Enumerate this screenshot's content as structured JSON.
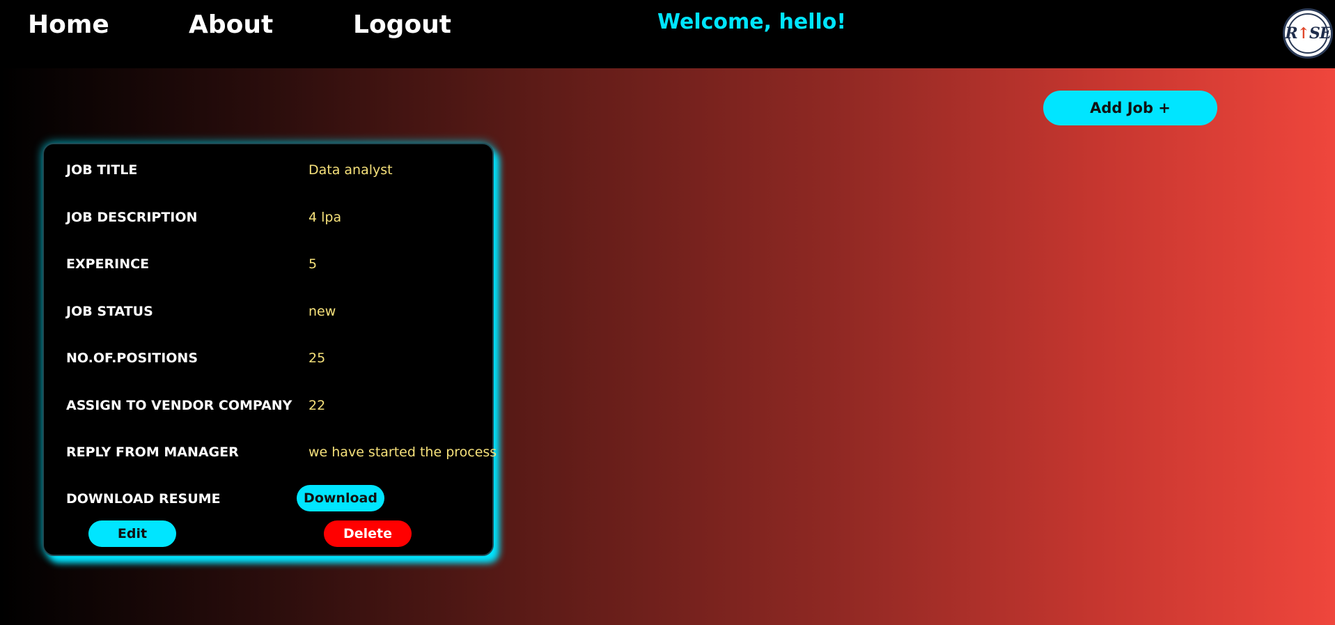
{
  "nav": {
    "home": "Home",
    "about": "About",
    "logout": "Logout",
    "welcome": "Welcome, hello!",
    "logo": {
      "text_left": "R",
      "arrow": "↑",
      "text_right": "SE"
    }
  },
  "actions": {
    "add_job": "Add Job +"
  },
  "job_card": {
    "rows": [
      {
        "label": "JOB TITLE",
        "value": "Data analyst"
      },
      {
        "label": "JOB DESCRIPTION",
        "value": "4 lpa"
      },
      {
        "label": "EXPERINCE",
        "value": "5"
      },
      {
        "label": "JOB STATUS",
        "value": "new"
      },
      {
        "label": "NO.OF.POSITIONS",
        "value": "25"
      },
      {
        "label": "ASSIGN TO VENDOR COMPANY",
        "value": "22"
      },
      {
        "label": "REPLY FROM MANAGER",
        "value": "we have started the process"
      }
    ],
    "download_label": "DOWNLOAD RESUME",
    "download_button": "Download",
    "edit_button": "Edit",
    "delete_button": "Delete"
  },
  "colors": {
    "accent": "#00e5ff",
    "danger": "#ff0000",
    "value_text": "#f5e07a",
    "gradient_end": "#ef463c"
  }
}
